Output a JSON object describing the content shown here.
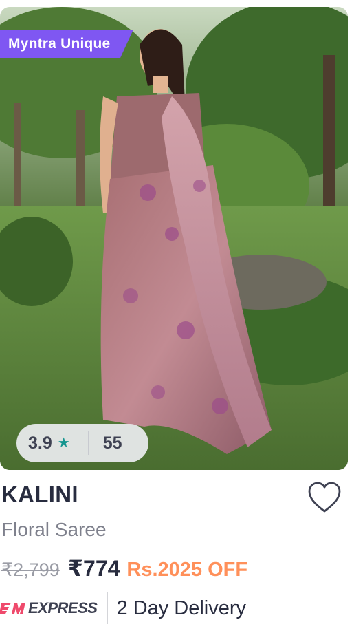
{
  "product": {
    "badge": "Myntra Unique",
    "rating": "3.9",
    "rating_star": "★",
    "rating_count": "55",
    "brand": "KALINI",
    "name": "Floral Saree",
    "mrp": "₹2,799",
    "price": "₹774",
    "discount": "Rs.2025 OFF"
  },
  "delivery": {
    "express_label": "EXPRESS",
    "text": "2 Day Delivery"
  },
  "colors": {
    "badge_bg": "#7f57f2",
    "star": "#14958f",
    "discount": "#ff905a",
    "text_dark": "#282c3f",
    "text_muted": "#7e808c",
    "express_mark": "#ef4a6c"
  },
  "icons": [
    "star-icon",
    "heart-outline-icon",
    "express-logo-icon"
  ]
}
